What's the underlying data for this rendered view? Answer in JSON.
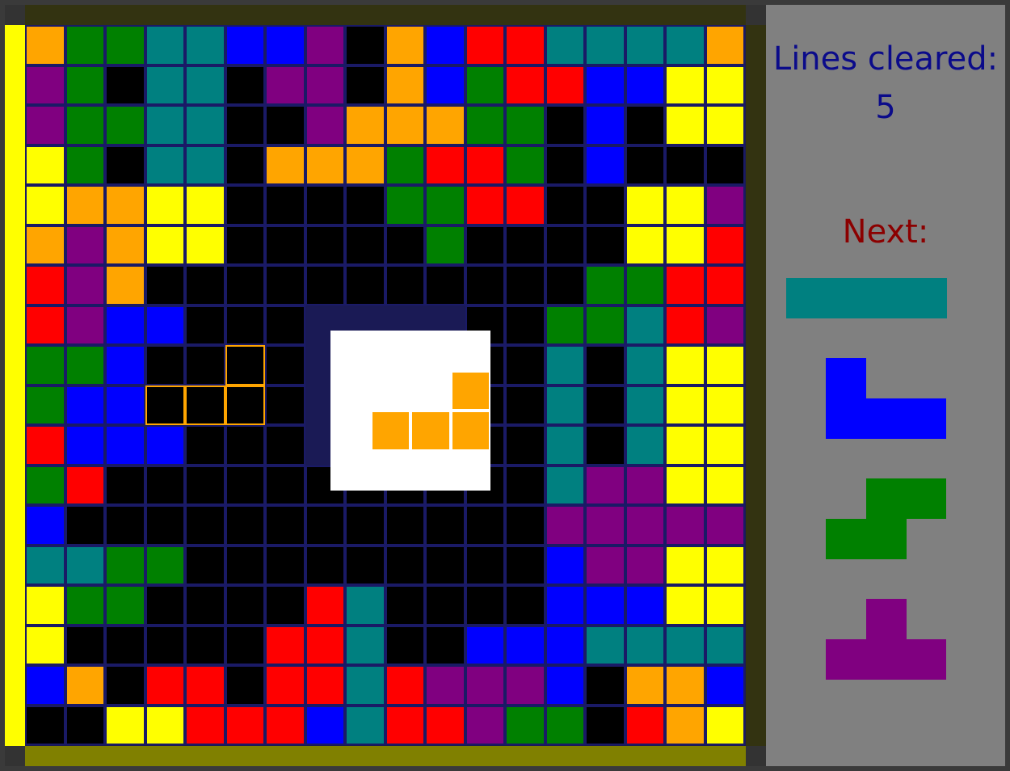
{
  "game": {
    "colors": {
      "O": "#ffa500",
      "G": "#008000",
      "C": "#008080",
      "B": "#0000ff",
      "P": "#800080",
      "K": "#000000",
      "R": "#ff0000",
      "Y": "#ffff00"
    },
    "board_rows": [
      "OGGCCBBPKOBRRCCCCO",
      "PGKCCKPPKOBGRRBBYY",
      "PGGCCKKPOOOGGKBKYY",
      "YGKCCKOOOGRRGKBKKK",
      "YOOYYKKKKGGRRKKYYP",
      "OPOYYKKKKKGKKKKYYR",
      "RPOKKKKKKKKKKKGGRR",
      "RPBBKKKKKKKKKGGCRP",
      "GGBKKKKKKKKKKCKCYY",
      "GBBKKKKKKKKKKCKCYY",
      "RBBBKKKKKKKKKCKCYY",
      "GRKKKKKKKKKKKCPPYY",
      "BKKKKKKKKKKKKPPPPP",
      "CCGGKKKKKKKKKBPPYY",
      "YGGKKKKRCKKKKBBBYY",
      "YKKKKKRRCKKBBBCCCC",
      "BOKRRKRRCRPPPBKOOB",
      "KKYYRRRBCRRPGGKROY"
    ],
    "ghost_cells": [
      [
        8,
        5
      ],
      [
        9,
        3
      ],
      [
        9,
        4
      ],
      [
        9,
        5
      ]
    ],
    "preview": {
      "color": "#ffa500",
      "cells": [
        [
          1,
          3
        ],
        [
          2,
          1
        ],
        [
          2,
          2
        ],
        [
          2,
          3
        ]
      ]
    }
  },
  "sidebar": {
    "lines_label": "Lines cleared:",
    "lines_value": "5",
    "next_label": "Next:",
    "next_pieces": [
      {
        "piece": "I",
        "color": "#008080",
        "cells": [
          [
            0,
            0
          ],
          [
            0,
            1
          ],
          [
            0,
            2
          ],
          [
            0,
            3
          ]
        ]
      },
      {
        "piece": "J",
        "color": "#0000ff",
        "cells": [
          [
            0,
            0
          ],
          [
            1,
            0
          ],
          [
            1,
            1
          ],
          [
            1,
            2
          ]
        ]
      },
      {
        "piece": "S",
        "color": "#008000",
        "cells": [
          [
            0,
            1
          ],
          [
            0,
            2
          ],
          [
            1,
            0
          ],
          [
            1,
            1
          ]
        ]
      },
      {
        "piece": "T",
        "color": "#800080",
        "cells": [
          [
            0,
            1
          ],
          [
            1,
            0
          ],
          [
            1,
            1
          ],
          [
            1,
            2
          ]
        ]
      }
    ]
  }
}
